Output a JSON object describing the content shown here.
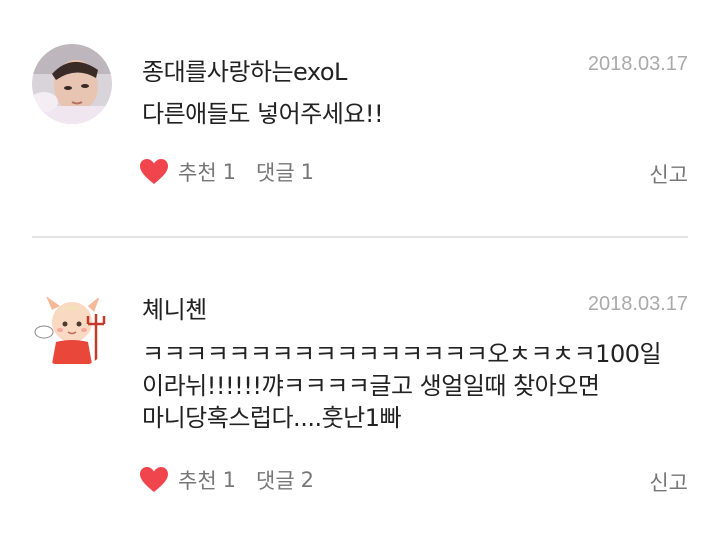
{
  "comments": [
    {
      "nickname": "종대를사랑하는exoL",
      "date": "2018.03.17",
      "text": "다른애들도 넣어주세요!!",
      "like_label": "추천",
      "like_count": "1",
      "reply_label": "댓글",
      "reply_count": "1",
      "report_label": "신고",
      "avatar_icon": "profile-photo"
    },
    {
      "nickname": "쳬니쳰",
      "date": "2018.03.17",
      "text": "ㅋㅋㅋㅋㅋㅋㅋㅋㅋㅋㅋㅋㅋㅋㅋㅋ오ㅊㅋㅊㅋ100일\n이라뉘!!!!!!꺄ㅋㅋㅋㅋ글고 생얼일때 찾아오면\n마니당혹스럽다....훗난1빠",
      "like_label": "추천",
      "like_count": "1",
      "reply_label": "댓글",
      "reply_count": "2",
      "report_label": "신고",
      "avatar_icon": "devil-character-illustration"
    }
  ],
  "colors": {
    "heart": "#f0454d",
    "muted": "#777777",
    "date": "#aaaaaa",
    "divider": "#e4e4e4"
  }
}
